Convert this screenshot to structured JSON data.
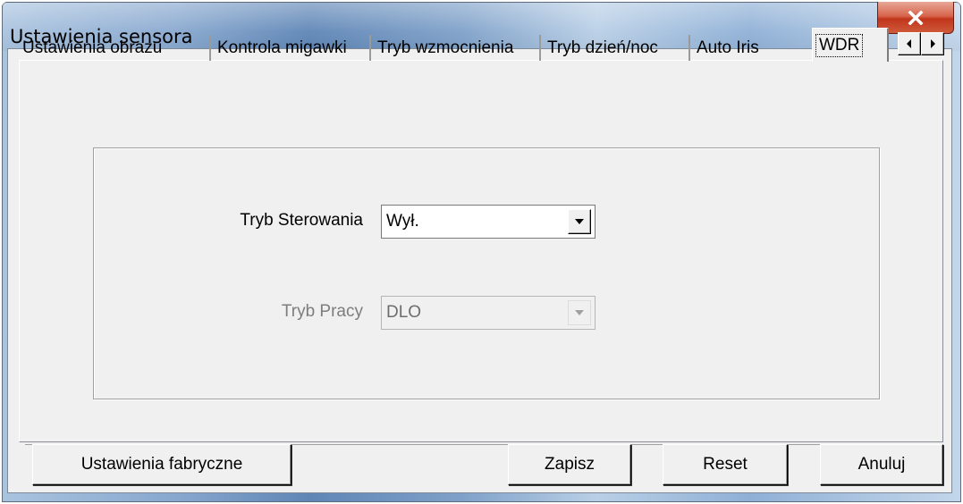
{
  "window": {
    "title": "Ustawienia sensora"
  },
  "tabs": [
    {
      "label": "Ustawienia obrazu"
    },
    {
      "label": "Kontrola migawki"
    },
    {
      "label": "Tryb wzmocnienia"
    },
    {
      "label": "Tryb dzień/noc"
    },
    {
      "label": "Auto Iris"
    },
    {
      "label": "WDR",
      "active": true
    }
  ],
  "wdr": {
    "control_mode": {
      "label": "Tryb Sterowania",
      "value": "Wył."
    },
    "work_mode": {
      "label": "Tryb Pracy",
      "value": "DLO",
      "disabled": true
    }
  },
  "buttons": {
    "factory": "Ustawienia fabryczne",
    "save": "Zapisz",
    "reset": "Reset",
    "cancel": "Anuluj"
  },
  "colors": {
    "close_button": "#c1361b",
    "panel": "#f0f0f0"
  },
  "icons": [
    "close-icon",
    "arrow-left-icon",
    "arrow-right-icon",
    "chevron-down-icon"
  ]
}
